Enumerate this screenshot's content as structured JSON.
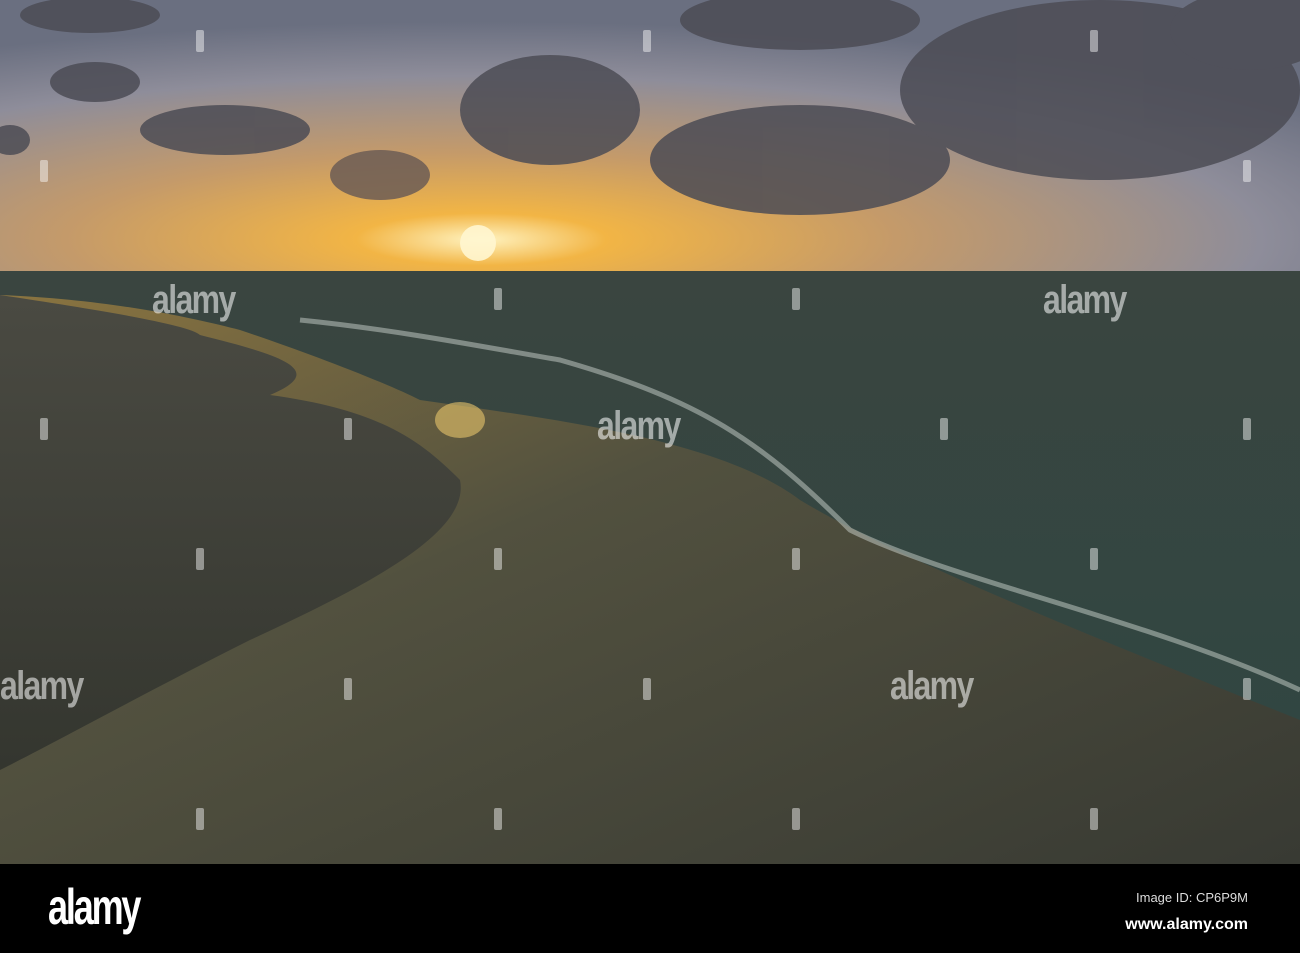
{
  "watermark": {
    "text": "alamy"
  },
  "footer": {
    "logo": "alamy",
    "image_id": "Image ID: CP6P9M",
    "website": "www.alamy.com"
  }
}
